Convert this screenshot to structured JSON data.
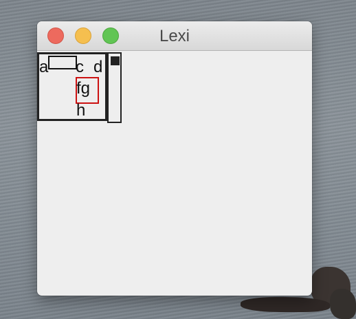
{
  "window": {
    "title": "Lexi"
  },
  "document": {
    "glyphs": [
      "a",
      "c",
      "d",
      "fg",
      "h"
    ]
  },
  "scrollbar": {
    "position": 0
  },
  "colors": {
    "selection_box": "#cc1111",
    "frame": "#222222"
  }
}
